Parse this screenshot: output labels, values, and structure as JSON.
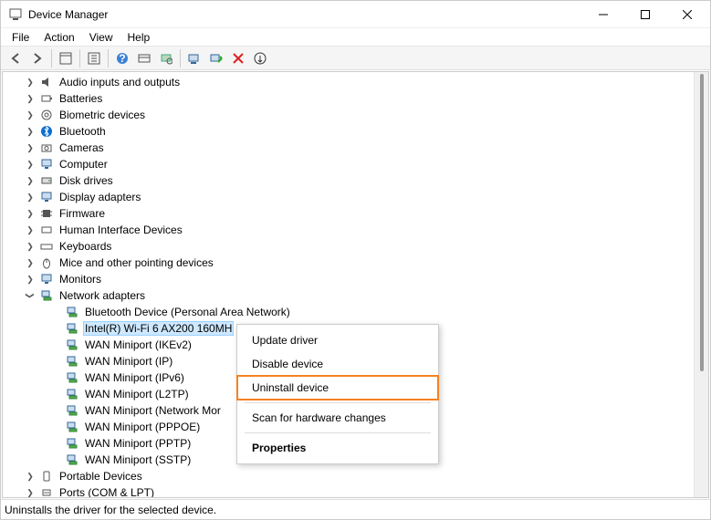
{
  "window": {
    "title": "Device Manager"
  },
  "menu": {
    "file": "File",
    "action": "Action",
    "view": "View",
    "help": "Help"
  },
  "tree": {
    "categories": [
      {
        "label": "Audio inputs and outputs"
      },
      {
        "label": "Batteries"
      },
      {
        "label": "Biometric devices"
      },
      {
        "label": "Bluetooth"
      },
      {
        "label": "Cameras"
      },
      {
        "label": "Computer"
      },
      {
        "label": "Disk drives"
      },
      {
        "label": "Display adapters"
      },
      {
        "label": "Firmware"
      },
      {
        "label": "Human Interface Devices"
      },
      {
        "label": "Keyboards"
      },
      {
        "label": "Mice and other pointing devices"
      },
      {
        "label": "Monitors"
      }
    ],
    "network": {
      "label": "Network adapters",
      "children": [
        {
          "label": "Bluetooth Device (Personal Area Network)"
        },
        {
          "label": "Intel(R) Wi-Fi 6 AX200 160MH",
          "selected": true
        },
        {
          "label": "WAN Miniport (IKEv2)"
        },
        {
          "label": "WAN Miniport (IP)"
        },
        {
          "label": "WAN Miniport (IPv6)"
        },
        {
          "label": "WAN Miniport (L2TP)"
        },
        {
          "label": "WAN Miniport (Network Mor"
        },
        {
          "label": "WAN Miniport (PPPOE)"
        },
        {
          "label": "WAN Miniport (PPTP)"
        },
        {
          "label": "WAN Miniport (SSTP)"
        }
      ]
    },
    "tail": [
      {
        "label": "Portable Devices"
      },
      {
        "label": "Ports (COM & LPT)"
      }
    ]
  },
  "context_menu": {
    "update": "Update driver",
    "disable": "Disable device",
    "uninstall": "Uninstall device",
    "scan": "Scan for hardware changes",
    "properties": "Properties"
  },
  "status": {
    "text": "Uninstalls the driver for the selected device."
  }
}
